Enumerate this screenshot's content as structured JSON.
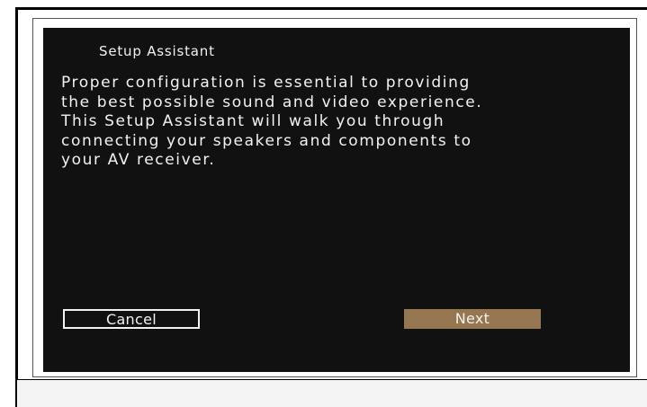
{
  "dialog": {
    "title": "Setup Assistant",
    "body_lines": [
      "Proper configuration is essential to providing",
      "the best possible sound and video experience.",
      "This Setup Assistant will walk you through",
      "connecting your speakers and components to",
      "your AV receiver."
    ],
    "cancel_label": "Cancel",
    "next_label": "Next"
  },
  "colors": {
    "screen_background": "#111111",
    "text": "#f2f2f2",
    "next_button": "#957650"
  }
}
